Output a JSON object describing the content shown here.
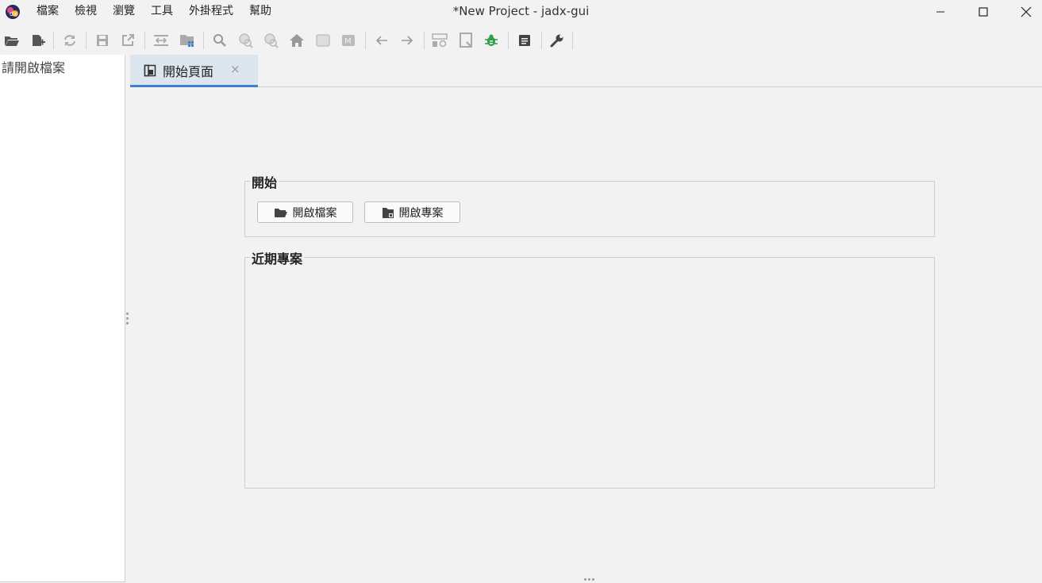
{
  "window": {
    "title": "*New Project - jadx-gui"
  },
  "menu": {
    "items": [
      "檔案",
      "檢視",
      "瀏覽",
      "工具",
      "外掛程式",
      "幫助"
    ]
  },
  "toolbar": {
    "icons": [
      "open-folder-icon",
      "add-files-icon",
      "reload-icon",
      "save-icon",
      "export-icon",
      "sync-icon",
      "flatten-packages-icon",
      "search-icon",
      "find-class-icon",
      "find-usage-icon",
      "home-icon",
      "frame-icon",
      "mapping-icon",
      "back-arrow-icon",
      "forward-arrow-icon",
      "deobfuscation-icon",
      "quick-preview-icon",
      "debug-bug-icon",
      "log-icon",
      "preferences-wrench-icon"
    ]
  },
  "left_panel": {
    "empty_text": "請開啟檔案"
  },
  "tabs": [
    {
      "label": "開始頁面",
      "close_symbol": "×",
      "active": true
    }
  ],
  "start_page": {
    "start_group": {
      "title": "開始",
      "open_file_button": "開啟檔案",
      "open_project_button": "開啟專案"
    },
    "recent_group": {
      "title": "近期專案",
      "items": []
    }
  },
  "colors": {
    "background": "#f2f2f2",
    "tab_active_bg": "#dde6ef",
    "tab_accent": "#3d7fd1",
    "debug_icon": "#2e9e4a"
  }
}
